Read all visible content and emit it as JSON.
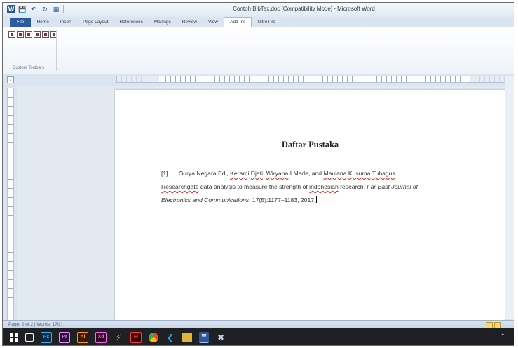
{
  "window": {
    "title": "Contoh BibTex.doc [Compatibility Mode] - Microsoft Word"
  },
  "quick_access": {
    "word_logo": "W",
    "icons": [
      "save-icon",
      "undo-icon",
      "redo-icon",
      "print-preview-icon"
    ]
  },
  "tabs": [
    {
      "label": "File"
    },
    {
      "label": "Home"
    },
    {
      "label": "Insert"
    },
    {
      "label": "Page Layout"
    },
    {
      "label": "References"
    },
    {
      "label": "Mailings"
    },
    {
      "label": "Review"
    },
    {
      "label": "View"
    },
    {
      "label": "Add-Ins"
    },
    {
      "label": "Nitro Pro"
    }
  ],
  "active_tab": "Add-Ins",
  "ribbon": {
    "group_label": "Custom Toolbars"
  },
  "document": {
    "heading": "Daftar Pustaka",
    "entry": {
      "number": "[1]",
      "authors_pre": "Surya Negara Edi, ",
      "a2": "Kerami",
      "a3": "Djati",
      "a4": "Wiryana",
      "a5": " I Made, and ",
      "a6": "Maulana",
      "a7": "Kusuma",
      "a8": "Tubagus",
      "t1": "Researchgate",
      "t2": " data analysis to measure the strength of ",
      "t3": "indonesian",
      "t4": " research. ",
      "journal_1": "Far East Journal of",
      "journal_2": "Electronics and Communications",
      "tail": ", 17(5):1177–1183, 2017."
    }
  },
  "statusbar": {
    "text": "Page: 2 of 2  |  Words: 170  |"
  },
  "taskbar": {
    "apps": [
      "Ps",
      "Pr",
      "Ai",
      "Xd",
      "Fl",
      "W"
    ]
  },
  "colors": {
    "file_tab": "#2a5b9f",
    "spell_underline": "#dd2222",
    "taskbar": "#1f2024"
  }
}
